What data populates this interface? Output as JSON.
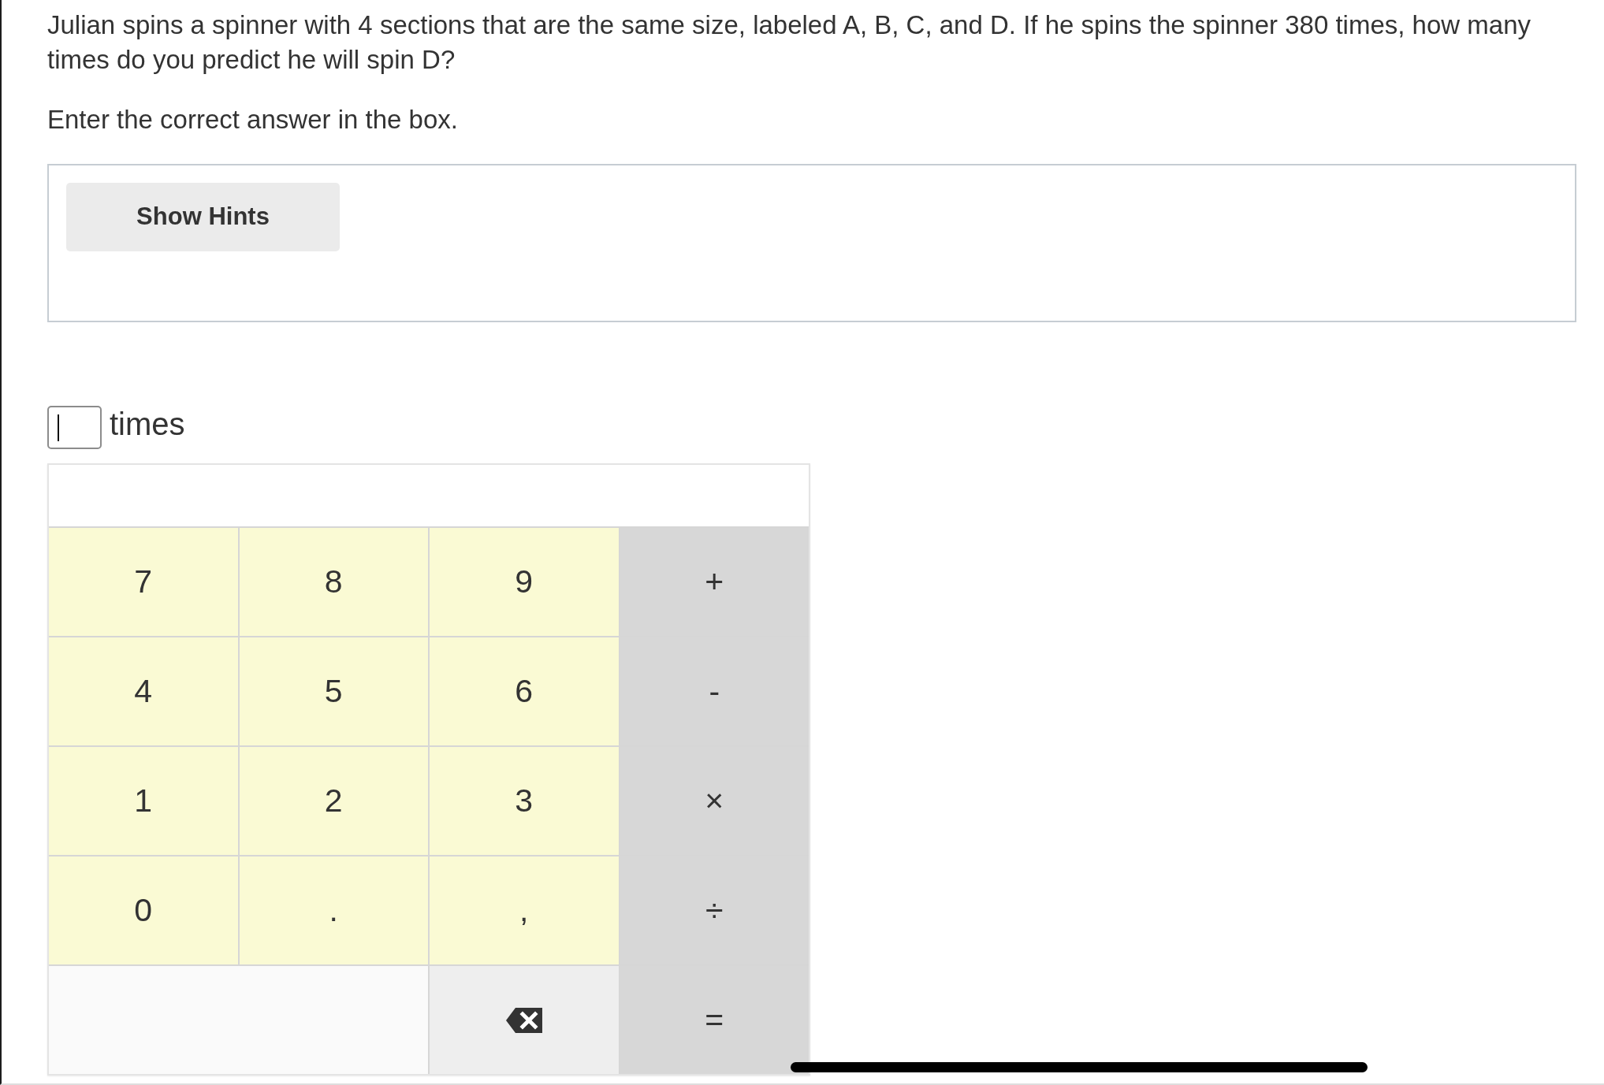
{
  "question": {
    "text": "Julian spins a spinner with 4 sections that are the same size, labeled A, B, C, and D. If he spins the spinner 380 times, how many times do you predict he will spin D?",
    "instruction": "Enter the correct answer in the box."
  },
  "hints": {
    "button": "Show Hints"
  },
  "answer": {
    "focused": true,
    "unit": "times"
  },
  "keypad": {
    "keys": [
      {
        "label": "7",
        "kind": "digit"
      },
      {
        "label": "8",
        "kind": "digit"
      },
      {
        "label": "9",
        "kind": "digit"
      },
      {
        "label": "+",
        "kind": "operator"
      },
      {
        "label": "4",
        "kind": "digit"
      },
      {
        "label": "5",
        "kind": "digit"
      },
      {
        "label": "6",
        "kind": "digit"
      },
      {
        "label": "-",
        "kind": "operator"
      },
      {
        "label": "1",
        "kind": "digit"
      },
      {
        "label": "2",
        "kind": "digit"
      },
      {
        "label": "3",
        "kind": "digit"
      },
      {
        "label": "×",
        "kind": "operator"
      },
      {
        "label": "0",
        "kind": "digit"
      },
      {
        "label": ".",
        "kind": "digit"
      },
      {
        "label": ",",
        "kind": "digit"
      },
      {
        "label": "÷",
        "kind": "operator"
      },
      {
        "kind": "blank"
      },
      {
        "kind": "backspace"
      },
      {
        "label": "=",
        "kind": "operator"
      }
    ]
  }
}
